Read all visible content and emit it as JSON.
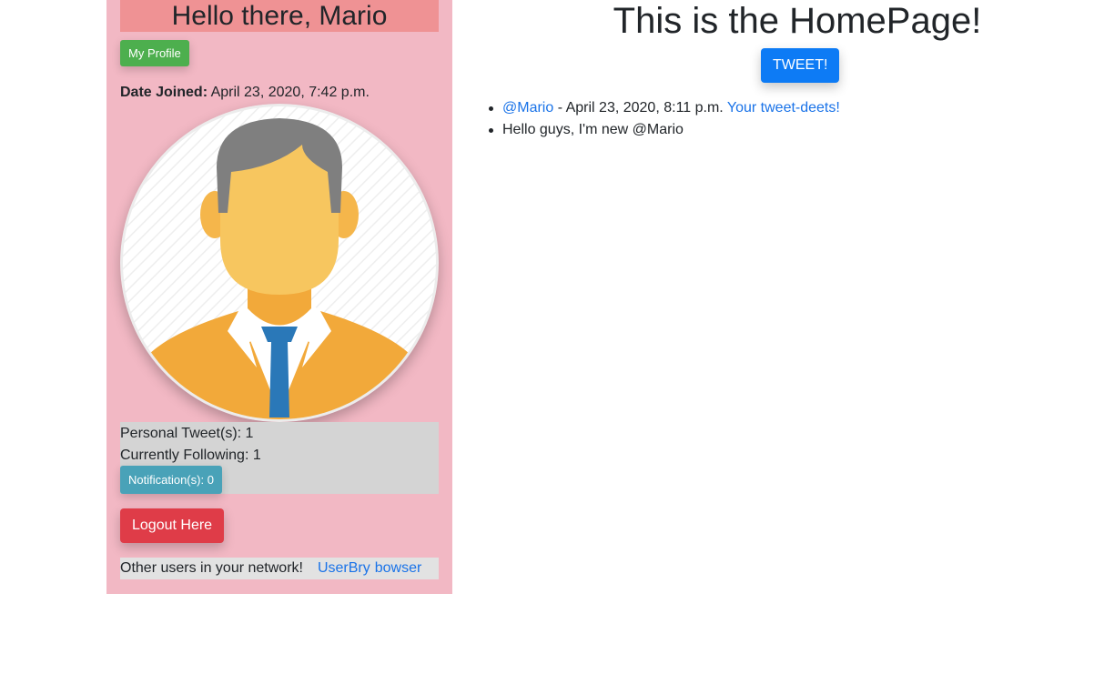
{
  "sidebar": {
    "greeting": "Hello there, Mario",
    "profile_button": "My Profile",
    "date_joined_label": "Date Joined:",
    "date_joined_value": "April 23, 2020, 7:42 p.m.",
    "personal_tweets": "Personal Tweet(s): 1",
    "currently_following": "Currently Following: 1",
    "notifications_button": "Notification(s): 0",
    "logout_button": "Logout Here",
    "network_label": "Other users in your network!",
    "network_users": [
      "UserBry",
      "bowser"
    ]
  },
  "main": {
    "title": "This is the HomePage!",
    "tweet_button": "TWEET!",
    "feed": {
      "author": "@Mario",
      "separator": " - ",
      "timestamp": "April 23, 2020, 8:11 p.m.",
      "details_link": "Your tweet-deets!",
      "message": "Hello guys, I'm new @Mario"
    }
  },
  "colors": {
    "sidebar_bg": "#f2b8c4",
    "greeting_bg": "#ef9294",
    "profile_button": "#4daf4e",
    "notifications_button": "#49a2b8",
    "logout_button": "#df3c48",
    "tweet_button": "#0d7bf5",
    "link": "#1a73e8"
  },
  "icons": {
    "avatar": "businessman-avatar-icon"
  }
}
